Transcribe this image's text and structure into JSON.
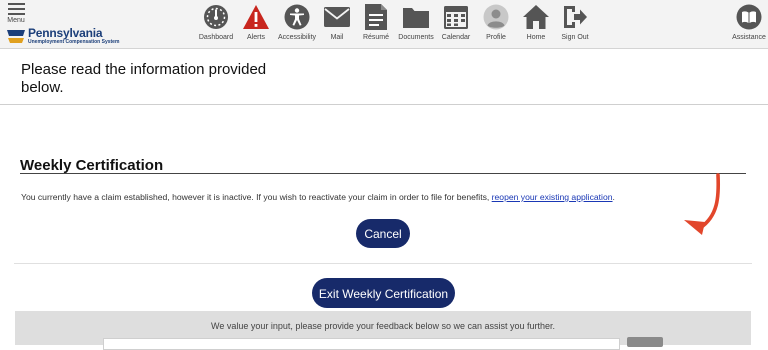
{
  "header": {
    "menu_label": "Menu",
    "logo": {
      "name": "Pennsylvania",
      "subtitle": "Unemployment Compensation System"
    },
    "nav": [
      {
        "label": "Dashboard",
        "icon": "dashboard-icon"
      },
      {
        "label": "Alerts",
        "icon": "alert-icon"
      },
      {
        "label": "Accessibility",
        "icon": "accessibility-icon"
      },
      {
        "label": "Mail",
        "icon": "mail-icon"
      },
      {
        "label": "Résumé",
        "icon": "resume-icon"
      },
      {
        "label": "Documents",
        "icon": "folder-icon"
      },
      {
        "label": "Calendar",
        "icon": "calendar-icon"
      },
      {
        "label": "Profile",
        "icon": "profile-icon"
      },
      {
        "label": "Home",
        "icon": "home-icon"
      },
      {
        "label": "Sign Out",
        "icon": "sign-out-icon"
      }
    ],
    "assistance_label": "Assistance"
  },
  "notice": {
    "text": "Please read the information provided below."
  },
  "certification": {
    "title": "Weekly Certification",
    "message": "You currently have a claim established, however it is inactive. If you wish to reactivate your claim in order to file for benefits, ",
    "link_text": "reopen your existing application",
    "message_end": ".",
    "cancel_label": "Cancel"
  },
  "exit_label": "Exit Weekly Certification",
  "feedback": {
    "text": "We value your input, please provide your feedback below so we can assist you further."
  },
  "colors": {
    "brand_navy": "#172a6a",
    "alert_red": "#c8261e",
    "annotation_arrow": "#e2462b",
    "link": "#1a38b5"
  }
}
